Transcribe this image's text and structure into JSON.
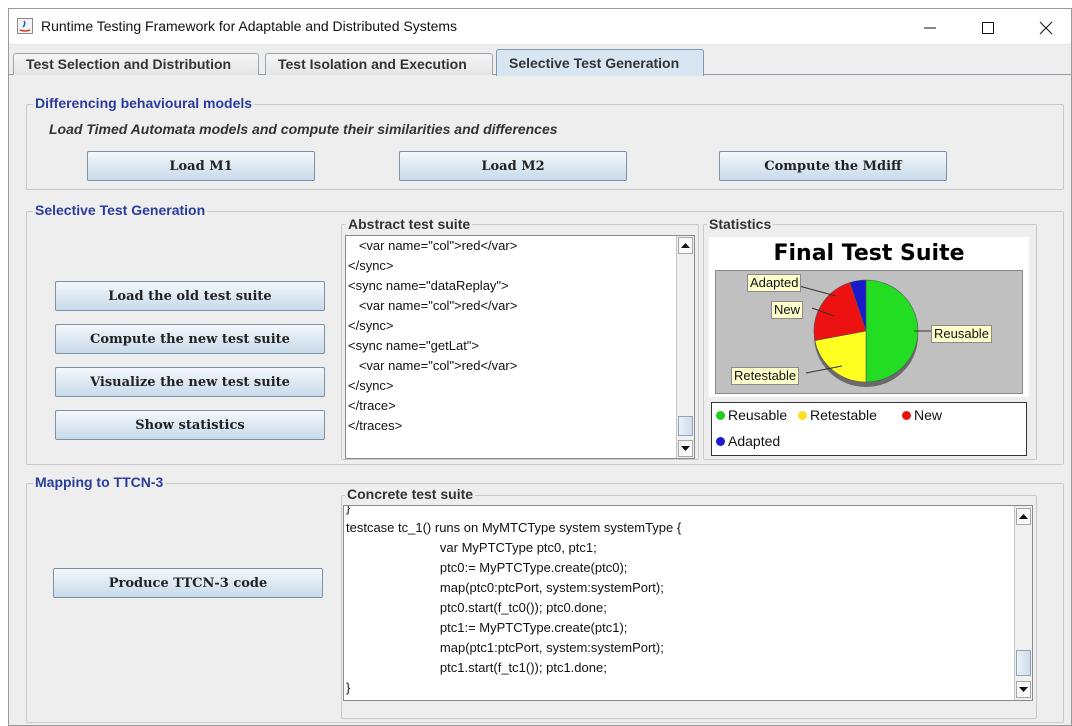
{
  "window": {
    "title": "Runtime Testing Framework for Adaptable and Distributed Systems"
  },
  "tabs": [
    {
      "label": "Test Selection and Distribution",
      "active": false
    },
    {
      "label": "Test Isolation and Execution",
      "active": false
    },
    {
      "label": "Selective Test Generation",
      "active": true
    }
  ],
  "diff_panel": {
    "title": "Differencing behavioural models",
    "subtitle": "Load Timed Automata models and compute their similarities and differences",
    "load_m1": "Load M1",
    "load_m2": "Load M2",
    "compute_mdiff": "Compute the Mdiff"
  },
  "selective_panel": {
    "title": "Selective Test Generation",
    "load_old": "Load the old test suite",
    "compute_new": "Compute  the new test suite",
    "visualize_new": "Visualize  the new test suite",
    "show_stats": "Show statistics",
    "abstract_title": "Abstract test suite",
    "abstract_lines": [
      "   <var name=\"col\">red</var>",
      "</sync>",
      "<sync name=\"dataReplay\">",
      "   <var name=\"col\">red</var>",
      "</sync>",
      "<sync name=\"getLat\">",
      "   <var name=\"col\">red</var>",
      "</sync>",
      "</trace>",
      "</traces>"
    ],
    "statistics_title": "Statistics"
  },
  "chart_data": {
    "type": "pie",
    "title": "Final  Test Suite",
    "slices": [
      {
        "name": "Reusable",
        "value": 50,
        "color": "#22dd22"
      },
      {
        "name": "Retestable",
        "value": 22,
        "color": "#ffff22"
      },
      {
        "name": "New",
        "value": 23,
        "color": "#ee1111"
      },
      {
        "name": "Adapted",
        "value": 5,
        "color": "#1a1acc"
      }
    ],
    "legend": [
      "Reusable",
      "Retestable",
      "New",
      "Adapted"
    ],
    "legend_placement": "bottom"
  },
  "ttcn_panel": {
    "title": "Mapping to TTCN-3",
    "produce": "Produce TTCN-3 code",
    "concrete_title": "Concrete test suite",
    "code_lines": [
      "}",
      "testcase tc_1() runs on MyMTCType system systemType {",
      "                          var MyPTCType ptc0, ptc1;",
      "                          ptc0:= MyPTCType.create(ptc0);",
      "                          map(ptc0:ptcPort, system:systemPort);",
      "                          ptc0.start(f_tc0()); ptc0.done;",
      "                          ptc1:= MyPTCType.create(ptc1);",
      "                          map(ptc1:ptcPort, system:systemPort);",
      "                          ptc1.start(f_tc1()); ptc1.done;",
      "}"
    ]
  }
}
